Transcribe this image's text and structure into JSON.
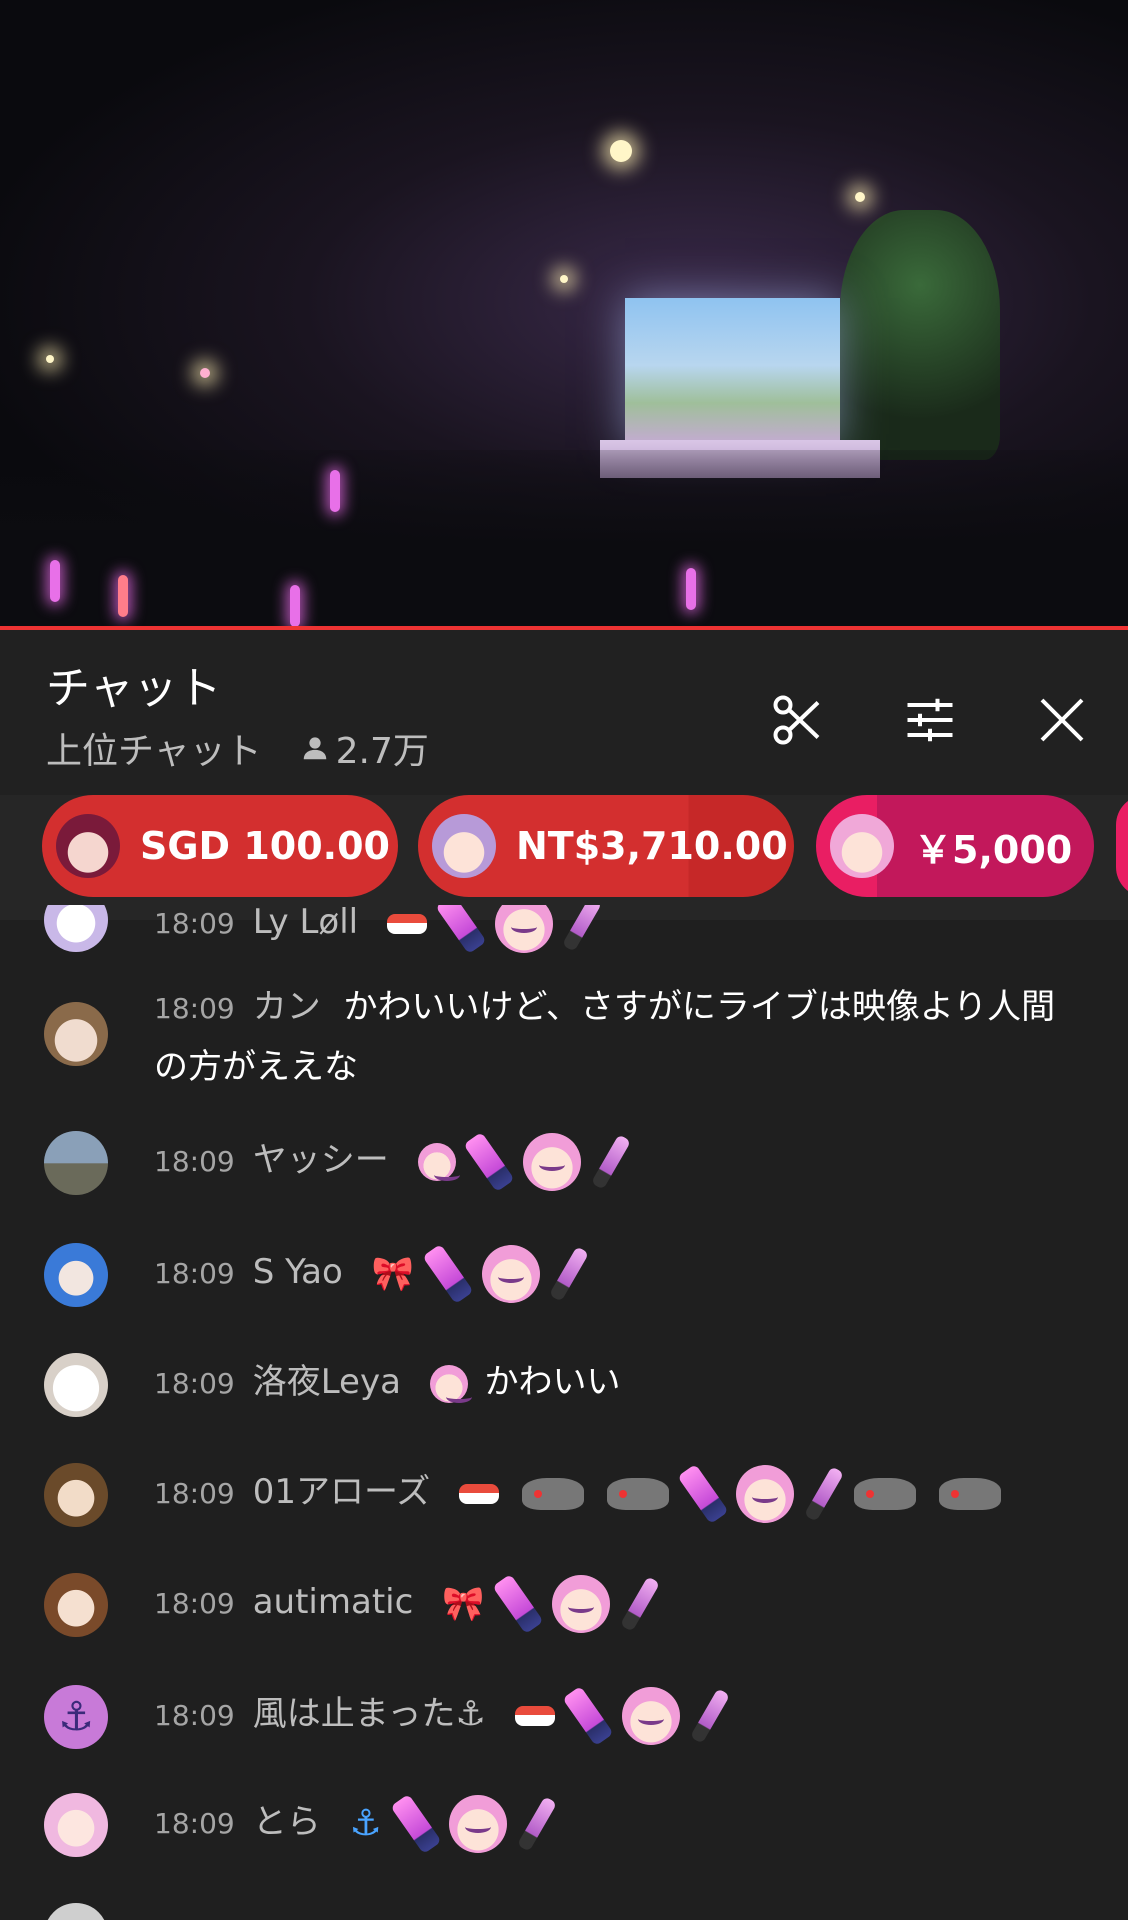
{
  "video": {
    "progress_color": "#e53935"
  },
  "header": {
    "title": "チャット",
    "mode_label": "上位チャット",
    "viewer_count": "2.7万"
  },
  "superchats": [
    {
      "amount": "SGD 100.00",
      "color": "#d32f2f"
    },
    {
      "amount": "NT$3,710.00",
      "color": "#d32f2f"
    },
    {
      "amount": "￥5,000",
      "color": "#c2185b"
    }
  ],
  "messages": [
    {
      "time": "18:09",
      "author": "Ly Løll",
      "text": ""
    },
    {
      "time": "18:09",
      "author": "カン",
      "text": "かわいいけど、さすがにライブは映像より人間の方がええな"
    },
    {
      "time": "18:09",
      "author": "ヤッシー",
      "text": ""
    },
    {
      "time": "18:09",
      "author": "S Yao",
      "text": ""
    },
    {
      "time": "18:09",
      "author": "洛夜Leya",
      "text": "かわいい"
    },
    {
      "time": "18:09",
      "author": "01アローズ",
      "text": ""
    },
    {
      "time": "18:09",
      "author": "autimatic",
      "text": ""
    },
    {
      "time": "18:09",
      "author": "風は止まった⚓",
      "text": ""
    },
    {
      "time": "18:09",
      "author": "とら",
      "text": ""
    }
  ]
}
